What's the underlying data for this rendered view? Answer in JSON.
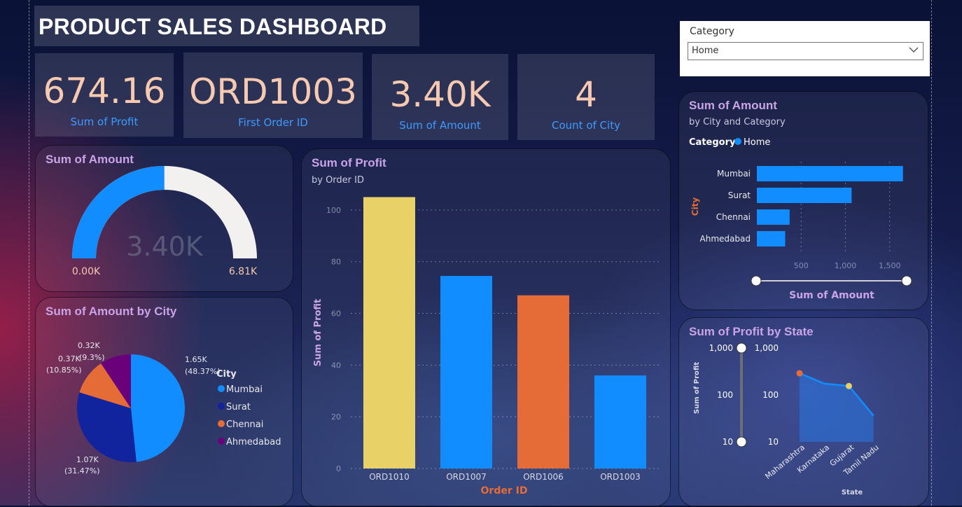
{
  "page": {
    "title": "PRODUCT SALES DASHBOARD"
  },
  "kpis": [
    {
      "value": "674.16",
      "label": "Sum of Profit"
    },
    {
      "value": "ORD1003",
      "label": "First Order ID"
    },
    {
      "value": "3.40K",
      "label": "Sum of Amount"
    },
    {
      "value": "4",
      "label": "Count of City"
    }
  ],
  "slicer": {
    "label": "Category",
    "selected": "Home"
  },
  "colors": {
    "blue": "#118dff",
    "navy": "#12239e",
    "orange": "#e66c37",
    "purple": "#6b007b",
    "yellow": "#e8d166",
    "gauge_bg": "#f3f0f0",
    "title": "#c9a4e6"
  },
  "chart_data": [
    {
      "type": "gauge",
      "title": "Sum of Amount",
      "value": 3.4,
      "min": 0.0,
      "max": 6.81,
      "value_label": "3.40K",
      "min_label": "0.00K",
      "max_label": "6.81K"
    },
    {
      "type": "pie",
      "title": "Sum of Amount by City",
      "legend_title": "City",
      "legend_position": "right",
      "slices": [
        {
          "name": "Mumbai",
          "value": 1.65,
          "label": "1.65K",
          "pct": "(48.37%)",
          "color": "#118dff"
        },
        {
          "name": "Surat",
          "value": 1.07,
          "label": "1.07K",
          "pct": "(31.47%)",
          "color": "#12239e"
        },
        {
          "name": "Chennai",
          "value": 0.37,
          "label": "0.37K",
          "pct": "(10.85%)",
          "color": "#e66c37"
        },
        {
          "name": "Ahmedabad",
          "value": 0.32,
          "label": "0.32K",
          "pct": "(9.3%)",
          "color": "#6b007b"
        }
      ]
    },
    {
      "type": "bar",
      "title": "Sum of Profit",
      "subtitle": "by Order ID",
      "xlabel": "Order ID",
      "ylabel": "Sum of Profit",
      "ylim": [
        0,
        110
      ],
      "yticks": [
        0,
        20,
        40,
        60,
        80,
        100
      ],
      "grid": true,
      "categories": [
        "ORD1010",
        "ORD1007",
        "ORD1006",
        "ORD1003"
      ],
      "values": [
        105,
        74.5,
        67,
        36
      ],
      "colors": [
        "#e8d166",
        "#118dff",
        "#e66c37",
        "#118dff"
      ]
    },
    {
      "type": "bar",
      "orientation": "horizontal",
      "title": "Sum of Amount",
      "subtitle": "by City and Category",
      "legend_title": "Category",
      "legend_items": [
        "Home"
      ],
      "xlabel": "Sum of Amount",
      "ylabel": "City",
      "categories": [
        "Mumbai",
        "Surat",
        "Chennai",
        "Ahmedabad"
      ],
      "values": [
        1650,
        1070,
        370,
        320
      ],
      "xlim": [
        0,
        1700
      ],
      "xticks": [
        {
          "v": 500,
          "l": "500"
        },
        {
          "v": 1000,
          "l": "1,000"
        },
        {
          "v": 1500,
          "l": "1,500"
        }
      ],
      "grid": true
    },
    {
      "type": "area",
      "title": "Sum of Profit by State",
      "xlabel": "State",
      "ylabel": "Sum of Profit",
      "log_scale": true,
      "ylim": [
        10,
        1000
      ],
      "yticks": [
        {
          "v": 10,
          "l": "10"
        },
        {
          "v": 100,
          "l": "100"
        },
        {
          "v": 1000,
          "l": "1,000"
        }
      ],
      "categories": [
        "Maharashtra",
        "Karnataka",
        "Gujarat",
        "Tamil Nadu"
      ],
      "x_positions": [
        0,
        0.7,
        1.4,
        2.1,
        3.0
      ],
      "values": [
        290,
        175,
        155,
        36
      ],
      "slider_labels": [
        "1,000",
        "100",
        "10"
      ]
    }
  ]
}
